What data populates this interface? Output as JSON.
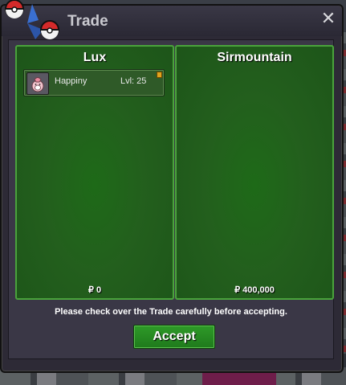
{
  "window": {
    "title": "Trade",
    "close_symbol": "✕"
  },
  "left_panel": {
    "name": "Lux",
    "money": "₽ 0",
    "items": [
      {
        "icon": "happiny-icon",
        "name": "Happiny",
        "level": "Lvl: 25"
      }
    ]
  },
  "right_panel": {
    "name": "Sirmountain",
    "money": "₽ 400,000"
  },
  "footer": {
    "notice": "Please check over the Trade carefully before accepting.",
    "accept_label": "Accept"
  },
  "colors": {
    "panel_green": "#235f1d",
    "panel_border": "#4aa33c",
    "accept_green": "#2e9a28",
    "window_bg": "#2d2a36"
  }
}
